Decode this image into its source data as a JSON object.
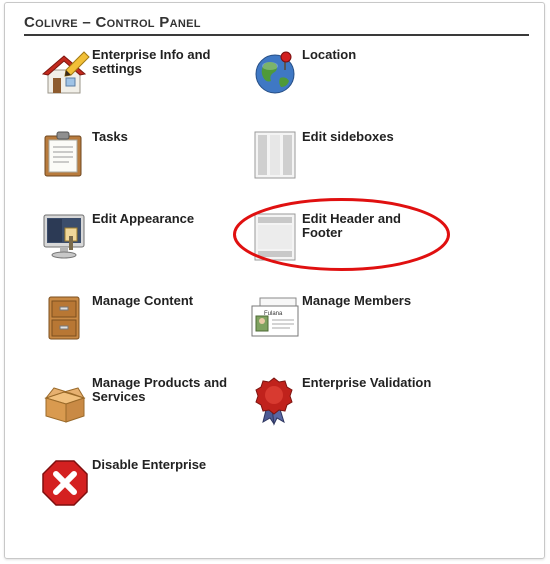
{
  "panel": {
    "title": "Colivre – Control Panel"
  },
  "items": [
    {
      "label": "Enterprise Info and settings",
      "icon": "house-pencil-icon"
    },
    {
      "label": "Location",
      "icon": "globe-pin-icon"
    },
    {
      "label": "Tasks",
      "icon": "clipboard-icon"
    },
    {
      "label": "Edit sideboxes",
      "icon": "sideboxes-layout-icon"
    },
    {
      "label": "Edit Appearance",
      "icon": "monitor-paint-icon"
    },
    {
      "label": "Edit Header and Footer",
      "icon": "header-footer-layout-icon"
    },
    {
      "label": "Manage Content",
      "icon": "drawer-icon"
    },
    {
      "label": "Manage Members",
      "icon": "id-cards-icon"
    },
    {
      "label": "Manage Products and Services",
      "icon": "open-box-icon"
    },
    {
      "label": "Enterprise Validation",
      "icon": "seal-icon"
    },
    {
      "label": "Disable Enterprise",
      "icon": "red-x-icon"
    }
  ],
  "member_card_name": "Fulana",
  "colors": {
    "highlight_ellipse": "#e01010",
    "title_rule": "#3a3a3a"
  }
}
